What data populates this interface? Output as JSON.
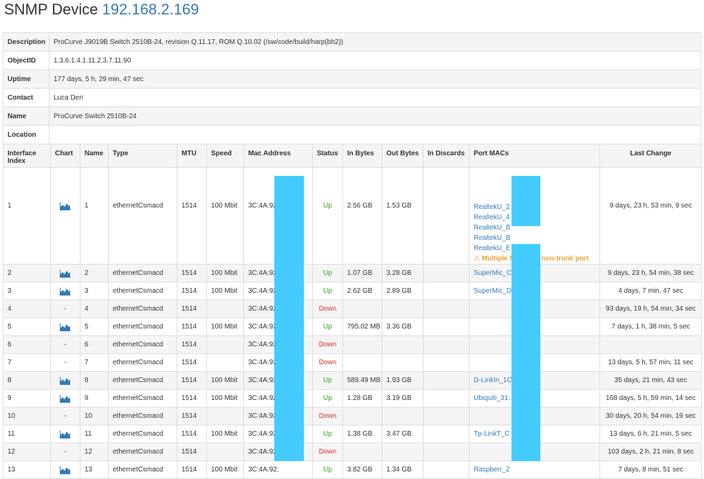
{
  "header": {
    "title": "SNMP Device",
    "ip": "192.168.2.169"
  },
  "info": [
    {
      "key": "Description",
      "value": "ProCurve J9019B Switch 2510B-24, revision Q.11.17, ROM Q.10.02 (/sw/code/build/harp(bh2))"
    },
    {
      "key": "ObjectID",
      "value": "1.3.6.1.4.1.11.2.3.7.11.90"
    },
    {
      "key": "Uptime",
      "value": "177 days, 5 h, 29 min, 47 sec"
    },
    {
      "key": "Contact",
      "value": "Luca Deri"
    },
    {
      "key": "Name",
      "value": "ProCurve Switch 2510B-24"
    },
    {
      "key": "Location",
      "value": ""
    }
  ],
  "columns": {
    "index_a": "Interface",
    "index_b": "Index",
    "chart": "Chart",
    "name": "Name",
    "type": "Type",
    "mtu": "MTU",
    "speed": "Speed",
    "mac": "Mac Address",
    "status": "Status",
    "in_bytes": "In Bytes",
    "out_bytes": "Out Bytes",
    "in_discards": "In Discards",
    "port_macs": "Port MACs",
    "last_change": "Last Change"
  },
  "warning": "Multiple MACs on non-trunk port",
  "rows": [
    {
      "index": "1",
      "chart": "chart-icon",
      "name": "1",
      "type": "ethernetCsmacd",
      "mtu": "1514",
      "speed": "100 Mbit",
      "mac": "3C:4A:92:",
      "status": "Up",
      "in": "2.56 GB",
      "out": "1.53 GB",
      "discards": "",
      "port_macs": [
        "RealtekU_2",
        "RealtekU_4",
        "RealtekU_B",
        "RealtekU_B",
        "RealtekU_E"
      ],
      "last_change": "9 days, 23 h, 53 min, 9 sec"
    },
    {
      "index": "2",
      "chart": "chart-icon",
      "name": "2",
      "type": "ethernetCsmacd",
      "mtu": "1514",
      "speed": "100 Mbit",
      "mac": "3C:4A:92:",
      "status": "Up",
      "in": "1.07 GB",
      "out": "3.28 GB",
      "discards": "",
      "port_macs": [
        "SuperMic_C"
      ],
      "last_change": "9 days, 23 h, 54 min, 38 sec"
    },
    {
      "index": "3",
      "chart": "chart-icon",
      "name": "3",
      "type": "ethernetCsmacd",
      "mtu": "1514",
      "speed": "100 Mbit",
      "mac": "3C:4A:92:",
      "status": "Up",
      "in": "2.62 GB",
      "out": "2.89 GB",
      "discards": "",
      "port_macs": [
        "SuperMic_D"
      ],
      "last_change": "4 days, 7 min, 47 sec"
    },
    {
      "index": "4",
      "chart": "-",
      "name": "4",
      "type": "ethernetCsmacd",
      "mtu": "1514",
      "speed": "",
      "mac": "3C:4A:92:",
      "status": "Down",
      "in": "",
      "out": "",
      "discards": "",
      "port_macs": [],
      "last_change": "93 days, 19 h, 54 min, 34 sec"
    },
    {
      "index": "5",
      "chart": "chart-icon",
      "name": "5",
      "type": "ethernetCsmacd",
      "mtu": "1514",
      "speed": "100 Mbit",
      "mac": "3C:4A:92:",
      "status": "Up",
      "in": "795.02 MB",
      "out": "3.36 GB",
      "discards": "",
      "port_macs": [],
      "last_change": "7 days, 1 h, 38 min, 5 sec"
    },
    {
      "index": "6",
      "chart": "-",
      "name": "6",
      "type": "ethernetCsmacd",
      "mtu": "1514",
      "speed": "",
      "mac": "3C:4A:92:",
      "status": "Down",
      "in": "",
      "out": "",
      "discards": "",
      "port_macs": [],
      "last_change": ""
    },
    {
      "index": "7",
      "chart": "-",
      "name": "7",
      "type": "ethernetCsmacd",
      "mtu": "1514",
      "speed": "",
      "mac": "3C:4A:92:",
      "status": "Down",
      "in": "",
      "out": "",
      "discards": "",
      "port_macs": [],
      "last_change": "13 days, 5 h, 57 min, 11 sec"
    },
    {
      "index": "8",
      "chart": "chart-icon",
      "name": "8",
      "type": "ethernetCsmacd",
      "mtu": "1514",
      "speed": "100 Mbit",
      "mac": "3C:4A:92:",
      "status": "Up",
      "in": "589.49 MB",
      "out": "1.93 GB",
      "discards": "",
      "port_macs": [
        "D-LinkIn_1C"
      ],
      "last_change": "35 days, 21 min, 43 sec"
    },
    {
      "index": "9",
      "chart": "chart-icon",
      "name": "9",
      "type": "ethernetCsmacd",
      "mtu": "1514",
      "speed": "100 Mbit",
      "mac": "3C:4A:92:",
      "status": "Up",
      "in": "1.28 GB",
      "out": "3.19 GB",
      "discards": "",
      "port_macs": [
        "Ubiquiti_31:"
      ],
      "last_change": "168 days, 5 h, 59 min, 14 sec"
    },
    {
      "index": "10",
      "chart": "-",
      "name": "10",
      "type": "ethernetCsmacd",
      "mtu": "1514",
      "speed": "",
      "mac": "3C:4A:92:",
      "status": "Down",
      "in": "",
      "out": "",
      "discards": "",
      "port_macs": [],
      "last_change": "30 days, 20 h, 54 min, 19 sec"
    },
    {
      "index": "11",
      "chart": "chart-icon",
      "name": "11",
      "type": "ethernetCsmacd",
      "mtu": "1514",
      "speed": "100 Mbit",
      "mac": "3C:4A:92:",
      "status": "Up",
      "in": "1.38 GB",
      "out": "3.47 GB",
      "discards": "",
      "port_macs": [
        "Tp-LinkT_C"
      ],
      "last_change": "13 days, 6 h, 21 min, 5 sec"
    },
    {
      "index": "12",
      "chart": "-",
      "name": "12",
      "type": "ethernetCsmacd",
      "mtu": "1514",
      "speed": "",
      "mac": "3C:4A:92:",
      "status": "Down",
      "in": "",
      "out": "",
      "discards": "",
      "port_macs": [],
      "last_change": "103 days, 2 h, 21 min, 8 sec"
    },
    {
      "index": "13",
      "chart": "chart-icon",
      "name": "13",
      "type": "ethernetCsmacd",
      "mtu": "1514",
      "speed": "100 Mbit",
      "mac": "3C:4A:92:",
      "status": "Up",
      "in": "3.82 GB",
      "out": "1.34 GB",
      "discards": "",
      "port_macs": [
        "Raspberr_2"
      ],
      "last_change": "7 days, 8 min, 51 sec"
    }
  ],
  "colors": {
    "link": "#337ab7",
    "up": "#3c9a2c",
    "down": "#d9302a",
    "warning": "#f0a030",
    "redaction": "#44ccff"
  }
}
